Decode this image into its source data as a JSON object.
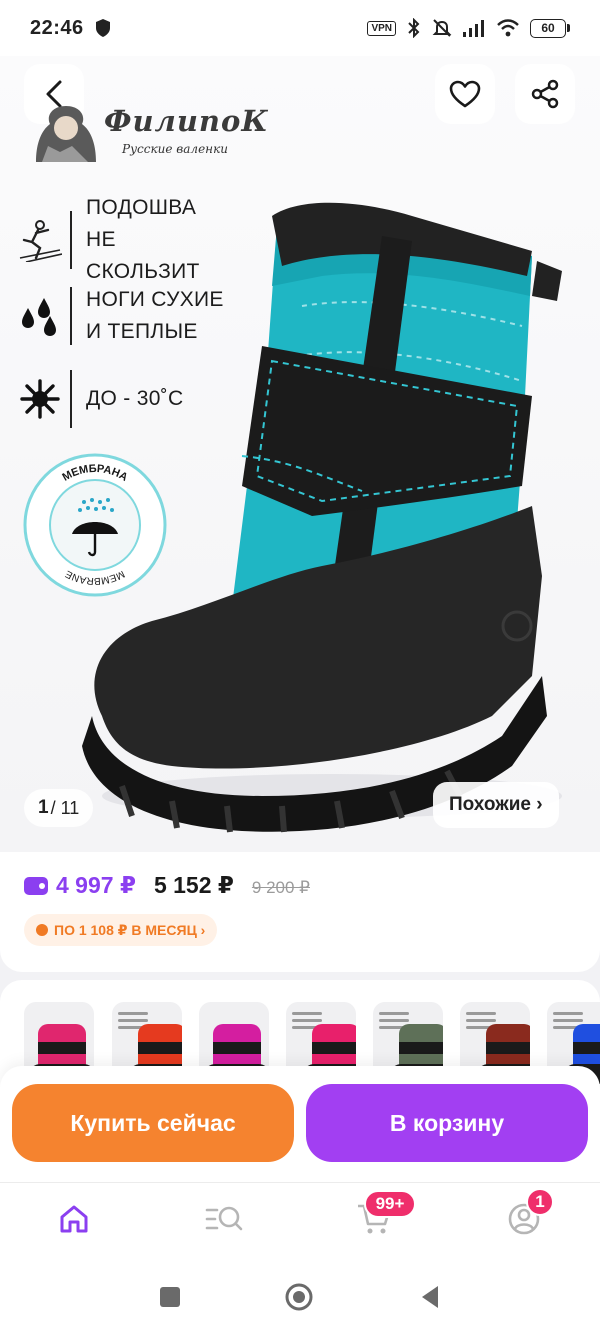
{
  "status_bar": {
    "time": "22:46",
    "vpn": "VPN",
    "battery": "60"
  },
  "brand": {
    "name": "ФилипоК",
    "tagline": "Русские валенки"
  },
  "features": [
    {
      "text": "ПОДОШВА НЕ СКОЛЬЗИТ",
      "icon": "slip-icon"
    },
    {
      "text": "НОГИ СУХИЕ И ТЕПЛЫЕ",
      "icon": "droplets-icon"
    },
    {
      "text": "ДО - 30˚С",
      "icon": "snowflake-icon"
    }
  ],
  "membrane_badge": {
    "label_ru": "МЕМБРАНА",
    "label_en": "MEMBRANE"
  },
  "gallery": {
    "counter_current": "1",
    "counter_total": "/ 11",
    "similar_label": "Похожие ›"
  },
  "price": {
    "wallet_price": "4 997 ₽",
    "current_price": "5 152 ₽",
    "old_price": "9 200 ₽",
    "installment": "ПО 1 108 ₽ В МЕСЯЦ ›"
  },
  "thumbnails": [
    {
      "color": "#e0266e",
      "type": "photo"
    },
    {
      "color": "#e53a1f",
      "type": "info"
    },
    {
      "color": "#d41ea0",
      "type": "photo"
    },
    {
      "color": "#e8206b",
      "type": "info"
    },
    {
      "color": "#5e7058",
      "type": "info"
    },
    {
      "color": "#8a2a1e",
      "type": "info"
    },
    {
      "color": "#1f4fe0",
      "type": "info"
    }
  ],
  "actions": {
    "buy_now": "Купить сейчас",
    "add_to_cart": "В корзину"
  },
  "bottom_nav": {
    "cart_badge": "99+",
    "profile_badge": "1",
    "active_color": "#8b3ff0"
  },
  "colors": {
    "accent_purple": "#a23ff2",
    "accent_orange": "#f5832f",
    "boot_teal": "#1fb6c4"
  }
}
